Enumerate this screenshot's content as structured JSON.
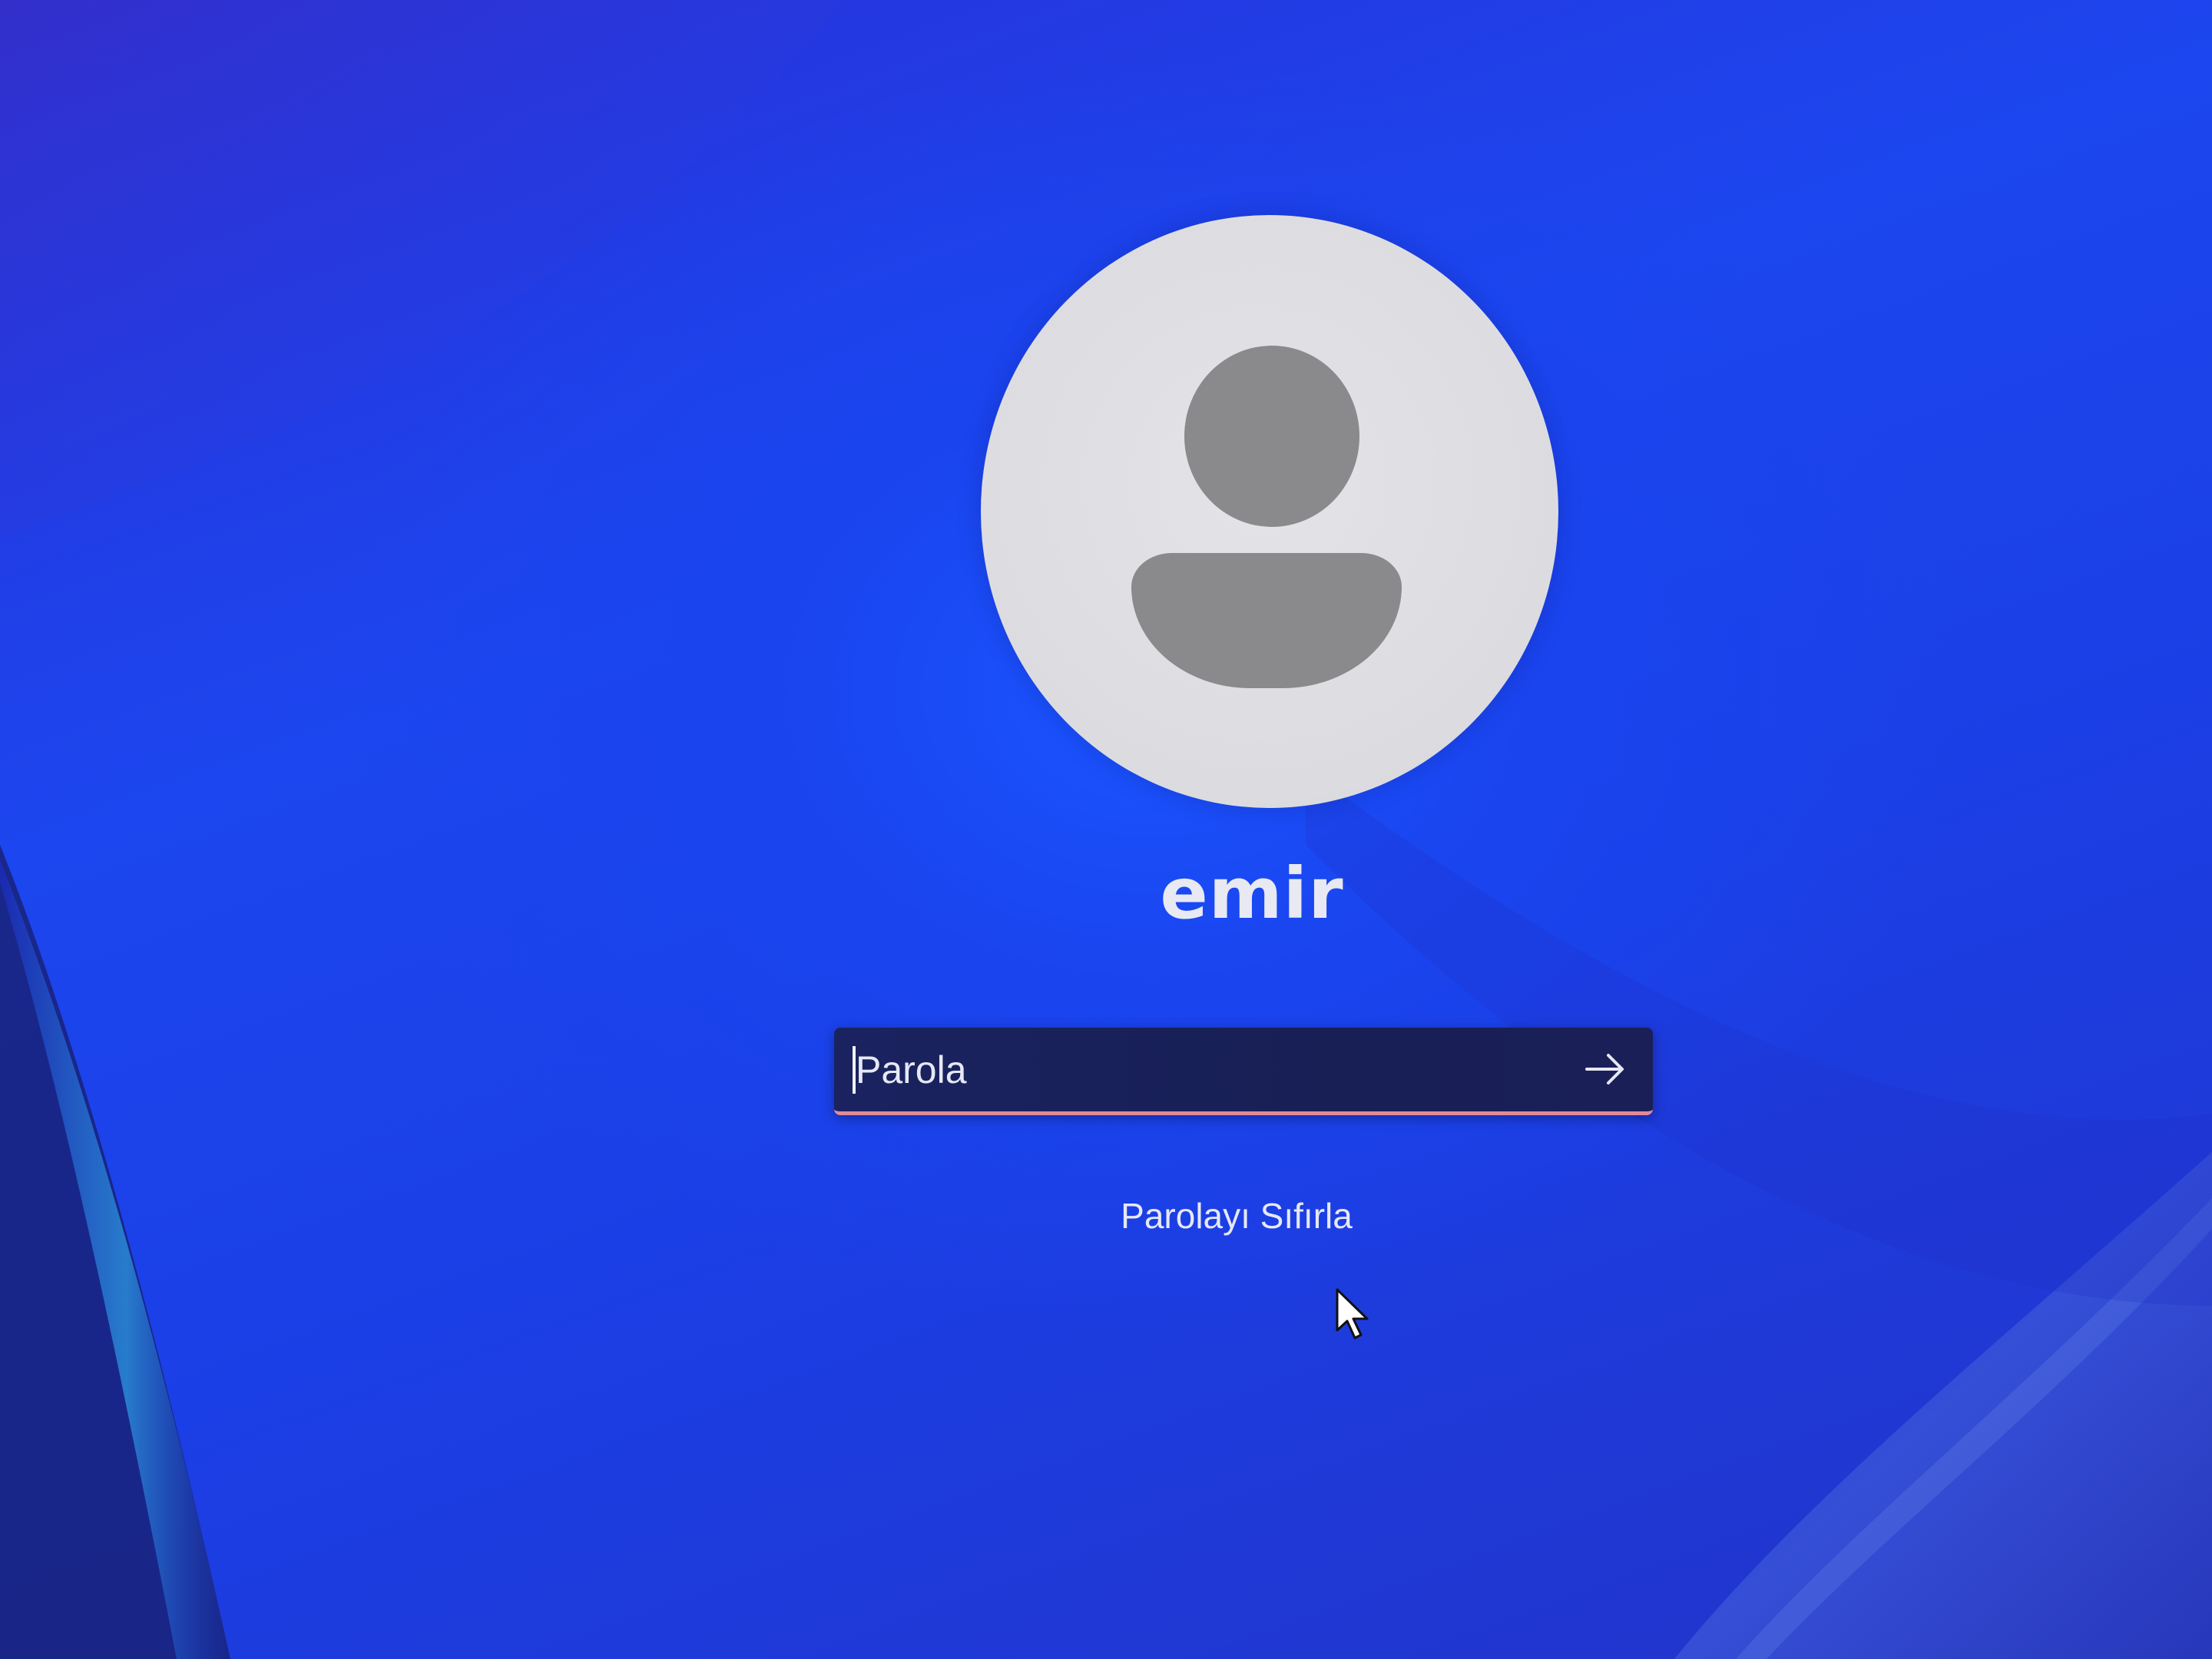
{
  "user": {
    "name": "emir"
  },
  "password": {
    "placeholder": "Parola",
    "value": ""
  },
  "actions": {
    "reset_password_label": "Parolayı Sıfırla"
  },
  "icons": {
    "avatar": "user-avatar-icon",
    "submit": "arrow-right-icon",
    "pointer": "mouse-pointer-icon"
  },
  "colors": {
    "background": "#1c46ef",
    "avatar_bg": "#dcdce0",
    "avatar_figure": "#8a8a8d",
    "input_bg": "#181f55",
    "input_underline": "#e28a98",
    "text": "#e6e8f5"
  }
}
